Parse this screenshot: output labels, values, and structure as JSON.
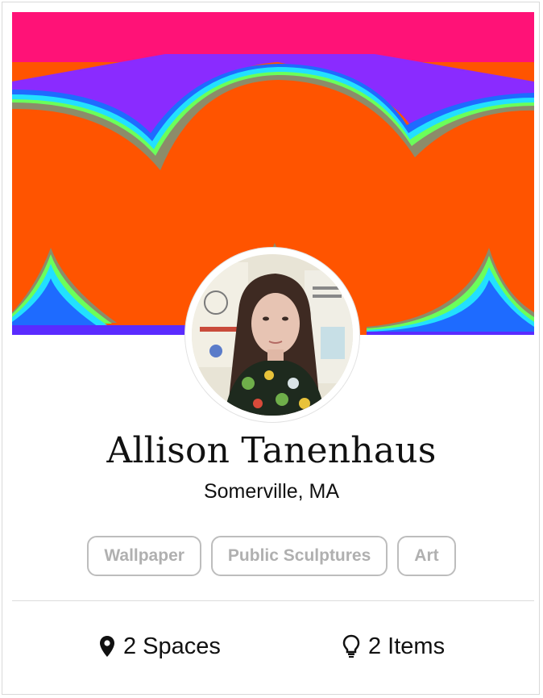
{
  "profile": {
    "name": "Allison Tanenhaus",
    "location": "Somerville, MA"
  },
  "tags": [
    "Wallpaper",
    "Public Sculptures",
    "Art"
  ],
  "stats": {
    "spaces": {
      "icon": "map-pin-icon",
      "label": "2 Spaces"
    },
    "items": {
      "icon": "lightbulb-icon",
      "label": "2 Items"
    }
  },
  "colors": {
    "cover_top": "#ff1277",
    "cover_main": "#ff5400",
    "tag_border": "#bdbdbd",
    "tag_text": "#b0b0b0"
  }
}
